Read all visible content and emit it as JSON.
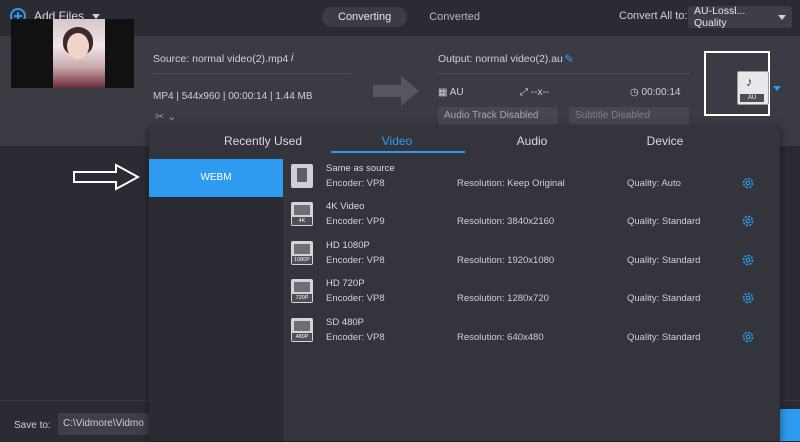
{
  "toolbar": {
    "add_files_label": "Add Files",
    "tabs": [
      {
        "label": "Converting",
        "active": true
      },
      {
        "label": "Converted",
        "active": false
      }
    ],
    "convert_all_label": "Convert All to:",
    "convert_all_value": "AU-Lossl... Quality"
  },
  "file_row": {
    "source_label": "Source: normal video(2).mp4",
    "info_icon": "i",
    "meta": "MP4 | 544x960 | 00:00:14 | 1.44 MB",
    "output_label": "Output: normal video(2).au",
    "out_format": "AU",
    "out_size": "--x--",
    "out_duration": "00:00:14",
    "audio_track": "Audio Track Disabled",
    "subtitle": "Subtitle Disabled",
    "format_badge": "AU"
  },
  "format_panel": {
    "tabs": [
      {
        "label": "Recently Used",
        "active": false
      },
      {
        "label": "Video",
        "active": true
      },
      {
        "label": "Audio",
        "active": false
      },
      {
        "label": "Device",
        "active": false
      }
    ],
    "sidebar": [
      {
        "label": "WEBM",
        "selected": true
      }
    ],
    "items": [
      {
        "name": "Same as source",
        "icon_label": "",
        "encoder": "Encoder: VP8",
        "resolution": "Resolution: Keep Original",
        "quality": "Quality: Auto"
      },
      {
        "name": "4K Video",
        "icon_label": "4K",
        "encoder": "Encoder: VP9",
        "resolution": "Resolution: 3840x2160",
        "quality": "Quality: Standard"
      },
      {
        "name": "HD 1080P",
        "icon_label": "1080P",
        "encoder": "Encoder: VP8",
        "resolution": "Resolution: 1920x1080",
        "quality": "Quality: Standard"
      },
      {
        "name": "HD 720P",
        "icon_label": "720P",
        "encoder": "Encoder: VP8",
        "resolution": "Resolution: 1280x720",
        "quality": "Quality: Standard"
      },
      {
        "name": "SD 480P",
        "icon_label": "480P",
        "encoder": "Encoder: VP8",
        "resolution": "Resolution: 640x480",
        "quality": "Quality: Standard"
      }
    ]
  },
  "bottom": {
    "save_to_label": "Save to:",
    "path": "C:\\Vidmore\\Vidmo"
  },
  "colors": {
    "accent": "#2f9bf0",
    "panel": "#33343c",
    "background": "#2b2c33"
  }
}
